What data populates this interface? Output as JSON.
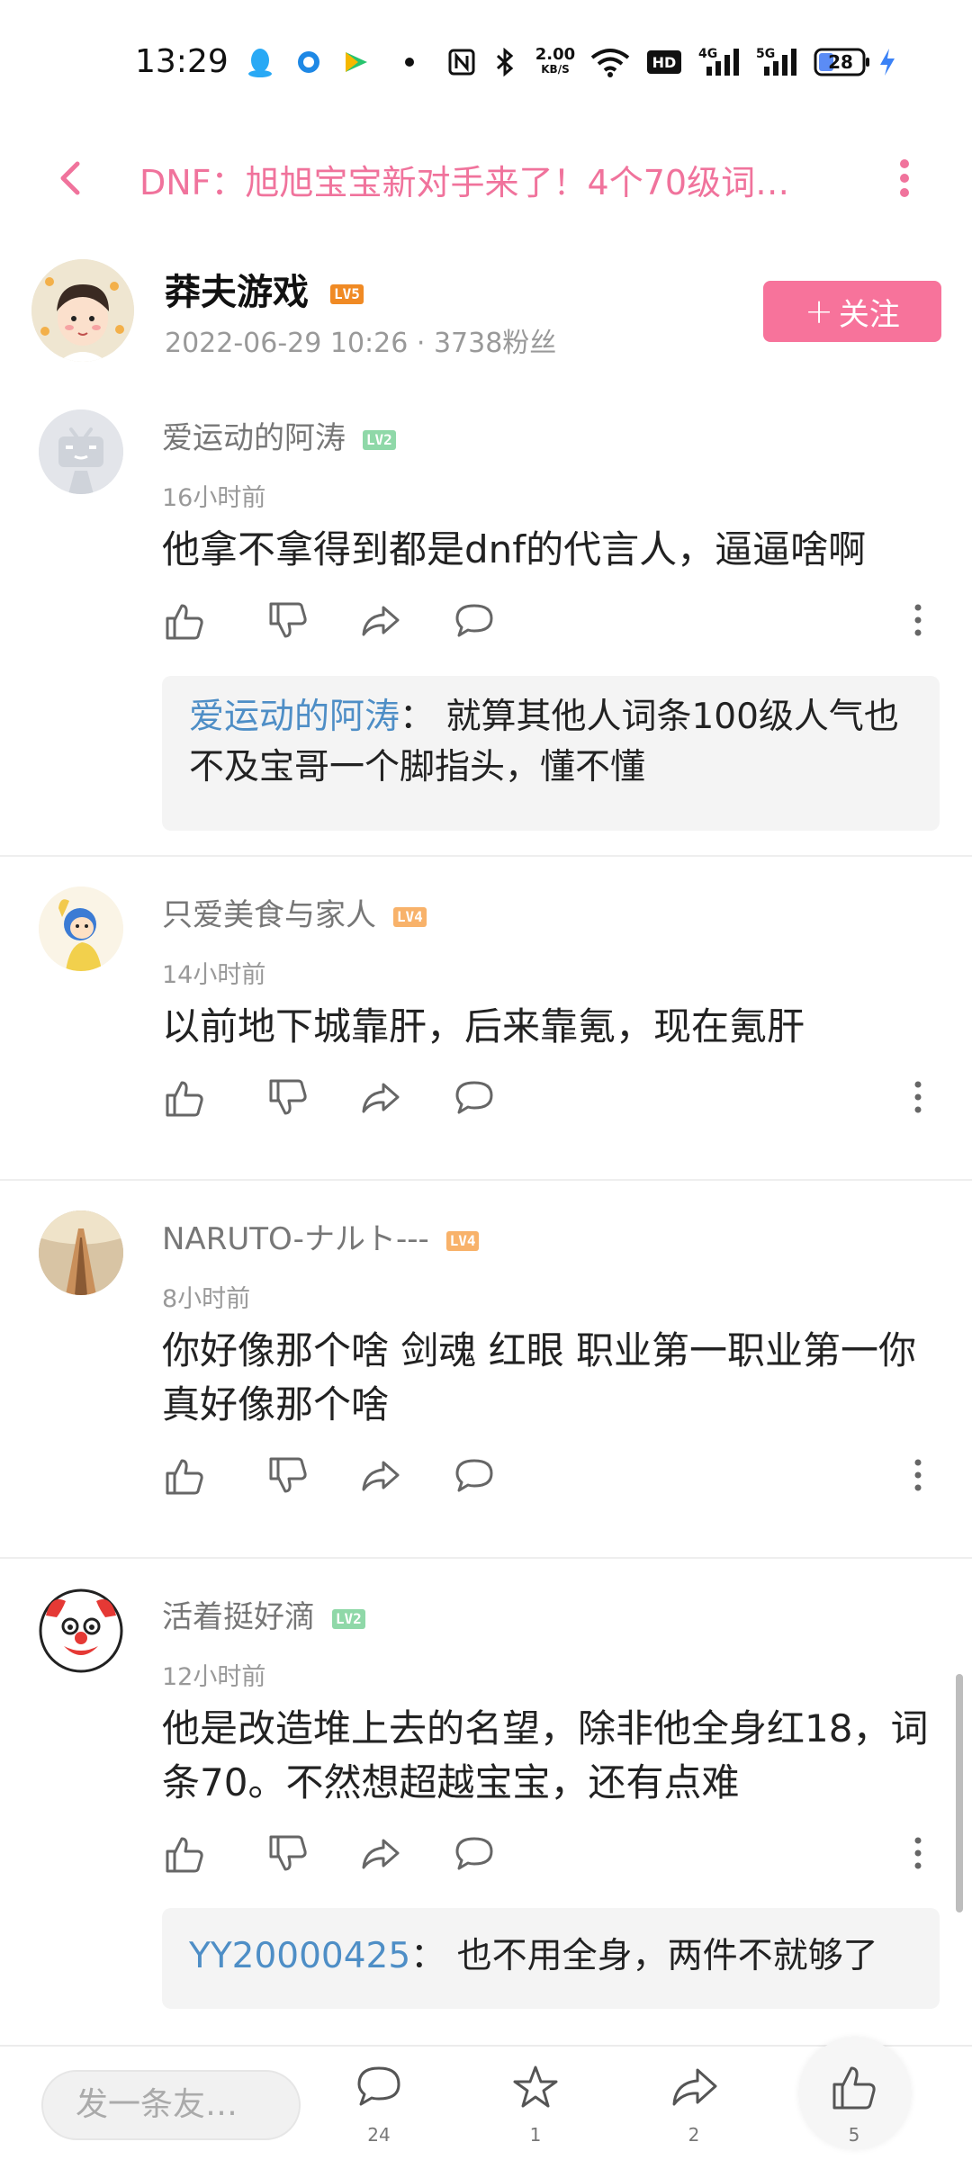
{
  "status_bar": {
    "time": "13:29",
    "net_speed_value": "2.00",
    "net_speed_unit": "KB/S",
    "hd_label": "HD",
    "signal_4g": "4G",
    "signal_5g": "5G",
    "battery": "28",
    "icons": [
      "qq-icon",
      "circle-app-icon",
      "play-app-icon",
      "dot-icon",
      "nfc-icon",
      "bluetooth-icon",
      "wifi-icon",
      "signal-icon",
      "battery-icon",
      "charging-icon"
    ]
  },
  "header": {
    "title": "DNF：旭旭宝宝新对手来了！4个70级词…",
    "accent_color": "#f0739c"
  },
  "author": {
    "name": "莽夫游戏",
    "level": "LV5",
    "meta": "2022-06-29 10:26 · 3738粉丝",
    "follow_label": "关注"
  },
  "comments": [
    {
      "name": "爱运动的阿涛",
      "level": "LV2",
      "time": "16小时前",
      "text": "他拿不拿得到都是dnf的代言人，逼逼啥啊",
      "reply": {
        "user": "爱运动的阿涛",
        "sep": "：",
        "text": "就算其他人词条100级人气也不及宝哥一个脚指头，懂不懂"
      }
    },
    {
      "name": "只爱美食与家人",
      "level": "LV4",
      "time": "14小时前",
      "text": "以前地下城靠肝，后来靠氪，现在氪肝"
    },
    {
      "name": "NARUTO-ナルト---",
      "level": "LV4",
      "time": "8小时前",
      "text": "你好像那个啥 剑魂 红眼 职业第一职业第一你真好像那个啥"
    },
    {
      "name": "活着挺好滴",
      "level": "LV2",
      "time": "12小时前",
      "text": "他是改造堆上去的名望，除非他全身红18，词条70。不然想超越宝宝，还有点难",
      "reply": {
        "user": "YY20000425",
        "sep": "：",
        "text": "也不用全身，两件不就够了"
      }
    }
  ],
  "bottom_bar": {
    "input_placeholder": "发一条友…",
    "comment_count": "24",
    "favorite_count": "1",
    "share_count": "2",
    "like_count": "5"
  },
  "colors": {
    "pink": "#f7739b",
    "lv2": "#8fd8a8",
    "lv4": "#f8b26a",
    "lv5": "#f08a24",
    "reply_user": "#4e8ec6"
  }
}
